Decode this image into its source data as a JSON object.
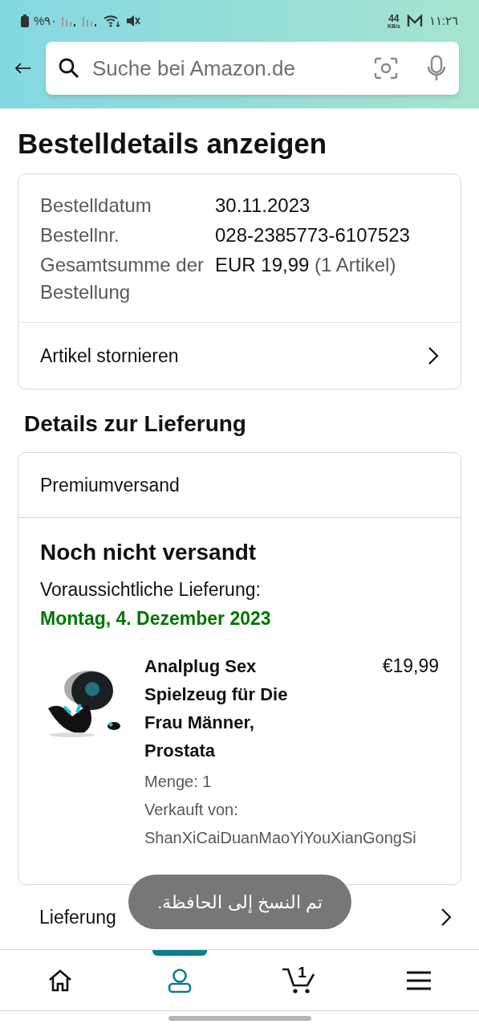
{
  "status_bar": {
    "battery": "%٩٠",
    "speed": "44",
    "speed_unit": "KB/s",
    "time": "١١:٢٦"
  },
  "search": {
    "placeholder": "Suche bei Amazon.de"
  },
  "title": "Bestelldetails anzeigen",
  "order_info": [
    {
      "label": "Bestelldatum",
      "value": "30.11.2023"
    },
    {
      "label": "Bestellnr.",
      "value": "028-2385773-6107523"
    },
    {
      "label": "Gesamtsumme der Bestellung",
      "value": "EUR 19,99",
      "note": "(1 Artikel)"
    }
  ],
  "order_action": "Artikel stornieren",
  "delivery_heading": "Details zur Lieferung",
  "shipping_method": "Premiumversand",
  "shipment_status": "Noch nicht versandt",
  "delivery_label": "Voraussichtliche Lieferung:",
  "delivery_date": "Montag, 4. Dezember 2023",
  "item": {
    "title": "Analplug Sex Spielzeug für Die Frau Männer, Prostata",
    "price": "€19,99",
    "quantity": "Menge: 1",
    "seller_label": "Verkauft von:",
    "seller": "ShanXiCaiDuanMaoYiYouXianGongSi"
  },
  "track_action": "Lieferung",
  "toast": "تم النسخ إلى الحافظة.",
  "bottom_nav": [
    {
      "selected": false
    },
    {
      "selected": true
    },
    {
      "badge": "1",
      "selected": false
    },
    {
      "selected": false
    }
  ]
}
